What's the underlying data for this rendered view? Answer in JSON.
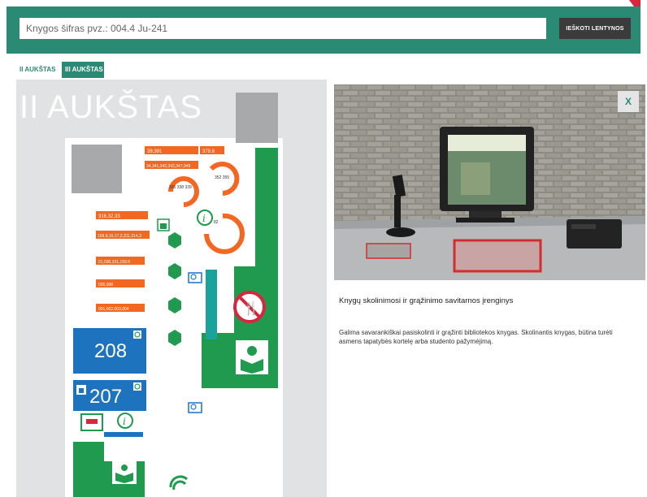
{
  "search": {
    "placeholder": "Knygos šifras pvz.: 004.4 Ju-241",
    "button_label": "IEŠKOTI LENTYNOS"
  },
  "tabs": [
    {
      "label": "II AUKŠTAS",
      "active": false
    },
    {
      "label": "III AUKŠTAS",
      "active": true
    }
  ],
  "map": {
    "title": "II AUKŠTAS",
    "shelf_labels": [
      "39,391",
      "379.8",
      "34,341,342,343,347,349",
      "316,32,33",
      "159.9,16,17,2,311,314,3",
      "01,030,101,159.9",
      "005,008",
      "001,002,003,004"
    ],
    "ring_labels": [
      "336 338 339",
      "352 355",
      "82"
    ],
    "rooms": [
      "208",
      "207"
    ]
  },
  "panel": {
    "close_label": "X",
    "title": "Knygų skolinimosi ir grąžinimo savitarnos įrenginys",
    "description": "Galima savarankiškai pasiskolinti ir grąžinti bibliotekos knygas. Skolinantis knygas, būtina turėti asmens tapatybės kortelę arba studento pažymėjimą."
  },
  "colors": {
    "brand_green": "#2a8a74",
    "map_green": "#1f9a4f",
    "shelf_orange": "#f26722",
    "room_blue": "#1e73be"
  }
}
